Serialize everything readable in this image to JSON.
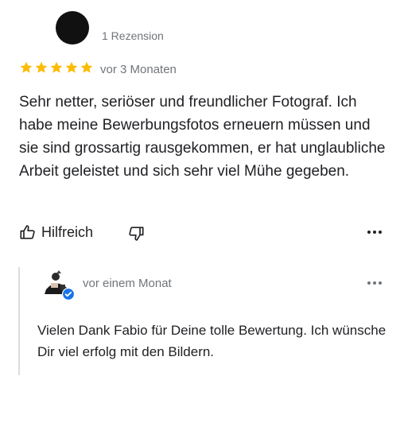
{
  "review": {
    "review_count": "1 Rezension",
    "rating": 5,
    "max_rating": 5,
    "date": "vor 3 Monaten",
    "text": "Sehr netter, seriöser und freundlicher Fotograf. Ich habe meine Bewerbungsfotos erneuern müssen und sie sind grossartig rausgekommen, er hat unglaubliche Arbeit geleistet und sich sehr viel Mühe gegeben.",
    "star_color": "#fbbc04"
  },
  "actions": {
    "helpful_label": "Hilfreich"
  },
  "reply": {
    "date": "vor einem Monat",
    "text": "Vielen Dank Fabio für Deine tolle Bewertung. Ich wünsche Dir viel erfolg mit den Bildern.",
    "verified_color": "#1a73e8"
  }
}
